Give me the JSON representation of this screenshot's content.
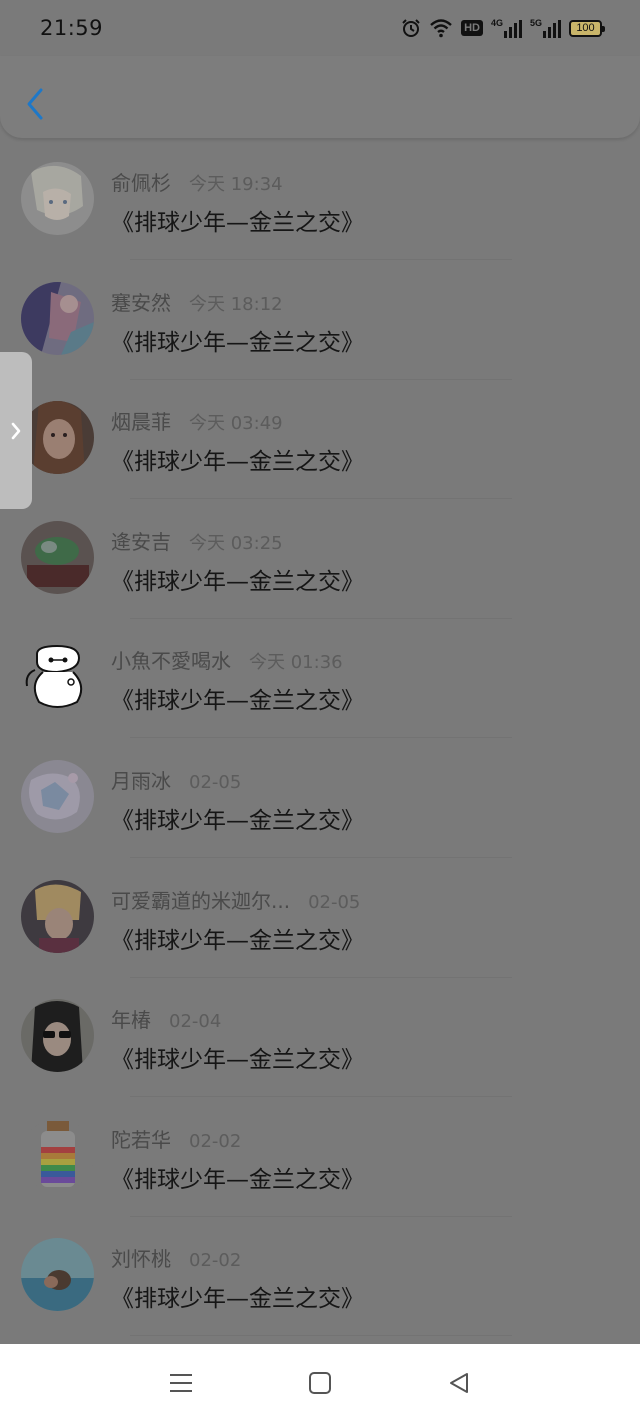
{
  "status_bar": {
    "time": "21:59",
    "hd_label": "HD",
    "net1_label": "4G",
    "net2_label": "5G",
    "battery_level": "100",
    "icons": [
      "alarm-icon",
      "wifi-icon",
      "hd-icon",
      "signal-icon",
      "signal-icon",
      "battery-icon"
    ]
  },
  "header": {
    "back_icon": "chevron-left-icon",
    "accent_color": "#1e78c8"
  },
  "list": {
    "items": [
      {
        "name": "俞佩杉",
        "time": "今天 19:34",
        "message": "《排球少年—金兰之交》"
      },
      {
        "name": "蹇安然",
        "time": "今天 18:12",
        "message": "《排球少年—金兰之交》"
      },
      {
        "name": "烟晨菲",
        "time": "今天 03:49",
        "message": "《排球少年—金兰之交》"
      },
      {
        "name": "逄安吉",
        "time": "今天 03:25",
        "message": "《排球少年—金兰之交》"
      },
      {
        "name": "小魚不愛喝水",
        "time": "今天 01:36",
        "message": "《排球少年—金兰之交》"
      },
      {
        "name": "月雨冰",
        "time": "02-05",
        "message": "《排球少年—金兰之交》"
      },
      {
        "name": "可爱霸道的米迦尔...",
        "time": "02-05",
        "message": "《排球少年—金兰之交》"
      },
      {
        "name": "年椿",
        "time": "02-04",
        "message": "《排球少年—金兰之交》"
      },
      {
        "name": "陀若华",
        "time": "02-02",
        "message": "《排球少年—金兰之交》"
      },
      {
        "name": "刘怀桃",
        "time": "02-02",
        "message": "《排球少年—金兰之交》"
      }
    ]
  },
  "side_handle": {
    "icon": "chevron-right-icon"
  },
  "nav_bar": {
    "icons": [
      "menu-icon",
      "home-icon",
      "back-icon"
    ]
  }
}
